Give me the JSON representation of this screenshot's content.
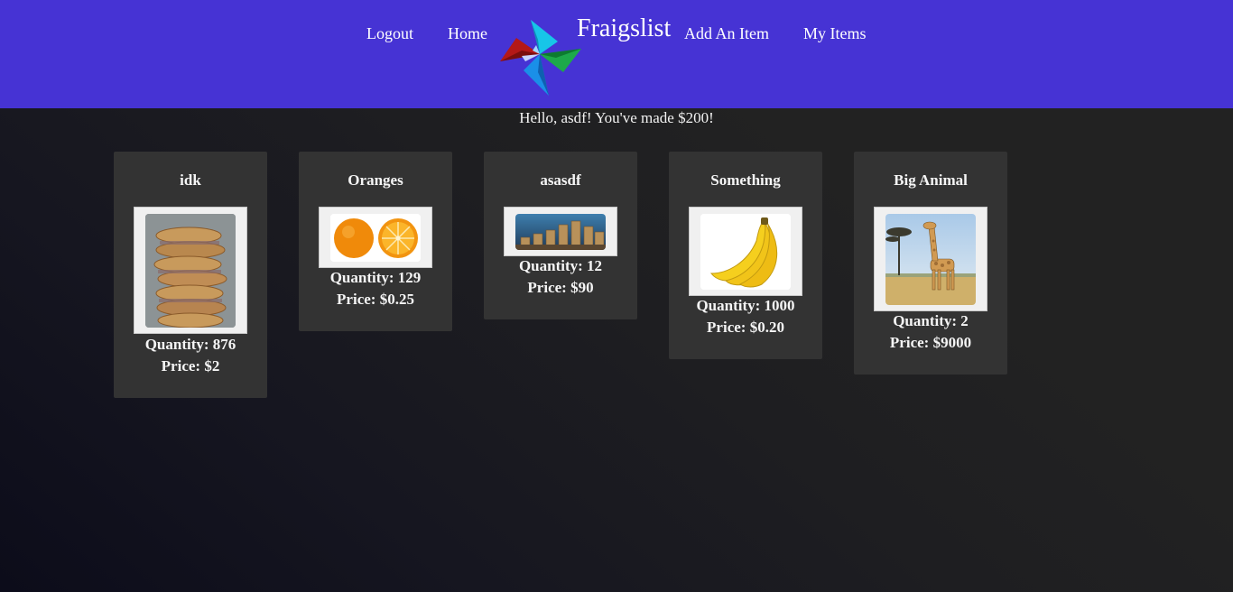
{
  "nav": {
    "logout": "Logout",
    "home": "Home",
    "brand": "Fraigslist",
    "add_item": "Add An Item",
    "my_items": "My Items"
  },
  "greeting": "Hello, asdf! You've made $200!",
  "colors": {
    "header_bg": "#4633d4",
    "card_bg": "#333333"
  },
  "items": [
    {
      "title": "idk",
      "quantity": "Quantity: 876",
      "price": "Price: $2",
      "image": "stacked-cookies"
    },
    {
      "title": "Oranges",
      "quantity": "Quantity: 129",
      "price": "Price: $0.25",
      "image": "oranges"
    },
    {
      "title": "asasdf",
      "quantity": "Quantity: 12",
      "price": "Price: $90",
      "image": "coin-stacks"
    },
    {
      "title": "Something",
      "quantity": "Quantity: 1000",
      "price": "Price: $0.20",
      "image": "bananas"
    },
    {
      "title": "Big Animal",
      "quantity": "Quantity: 2",
      "price": "Price: $9000",
      "image": "giraffe"
    }
  ]
}
